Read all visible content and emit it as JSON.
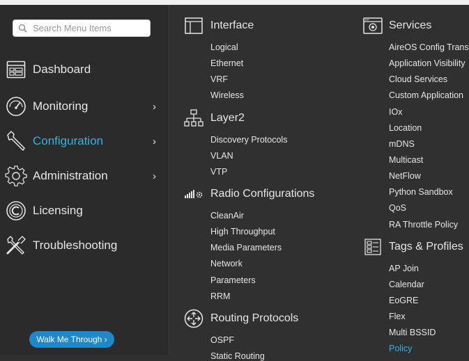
{
  "search": {
    "placeholder": "Search Menu Items"
  },
  "sidebar": {
    "items": [
      {
        "label": "Dashboard",
        "icon": "dashboard-icon",
        "has_submenu": false,
        "active": false
      },
      {
        "label": "Monitoring",
        "icon": "gauge-icon",
        "has_submenu": true,
        "active": false
      },
      {
        "label": "Configuration",
        "icon": "wrench-icon",
        "has_submenu": true,
        "active": true
      },
      {
        "label": "Administration",
        "icon": "gear-icon",
        "has_submenu": true,
        "active": false
      },
      {
        "label": "Licensing",
        "icon": "licensing-icon",
        "has_submenu": false,
        "active": false
      },
      {
        "label": "Troubleshooting",
        "icon": "tools-icon",
        "has_submenu": false,
        "active": false
      }
    ],
    "chevron": "›"
  },
  "walk_me": {
    "label": "Walk Me Through ›"
  },
  "menu": {
    "interface": {
      "title": "Interface",
      "icon": "interface-icon",
      "items": [
        "Logical",
        "Ethernet",
        "VRF",
        "Wireless"
      ]
    },
    "layer2": {
      "title": "Layer2",
      "icon": "layer2-icon",
      "items": [
        "Discovery Protocols",
        "VLAN",
        "VTP"
      ]
    },
    "radio": {
      "title": "Radio Configurations",
      "icon": "radio-config-icon",
      "items": [
        "CleanAir",
        "High Throughput",
        "Media Parameters",
        "Network",
        "Parameters",
        "RRM"
      ]
    },
    "routing": {
      "title": "Routing Protocols",
      "icon": "routing-icon",
      "items": [
        "OSPF",
        "Static Routing"
      ]
    },
    "services": {
      "title": "Services",
      "icon": "services-icon",
      "items": [
        "AireOS Config Translator",
        "Application Visibility",
        "Cloud Services",
        "Custom Application",
        "IOx",
        "Location",
        "mDNS",
        "Multicast",
        "NetFlow",
        "Python Sandbox",
        "QoS",
        "RA Throttle Policy"
      ]
    },
    "tags": {
      "title": "Tags & Profiles",
      "icon": "tags-profiles-icon",
      "items": [
        "AP Join",
        "Calendar",
        "EoGRE",
        "Flex",
        "Multi BSSID",
        "Policy"
      ],
      "active_item": "Policy"
    }
  },
  "colors": {
    "accent": "#2ab6e8",
    "background": "#303030",
    "sidebar": "#2b2b2b",
    "button": "#1e88c9"
  }
}
